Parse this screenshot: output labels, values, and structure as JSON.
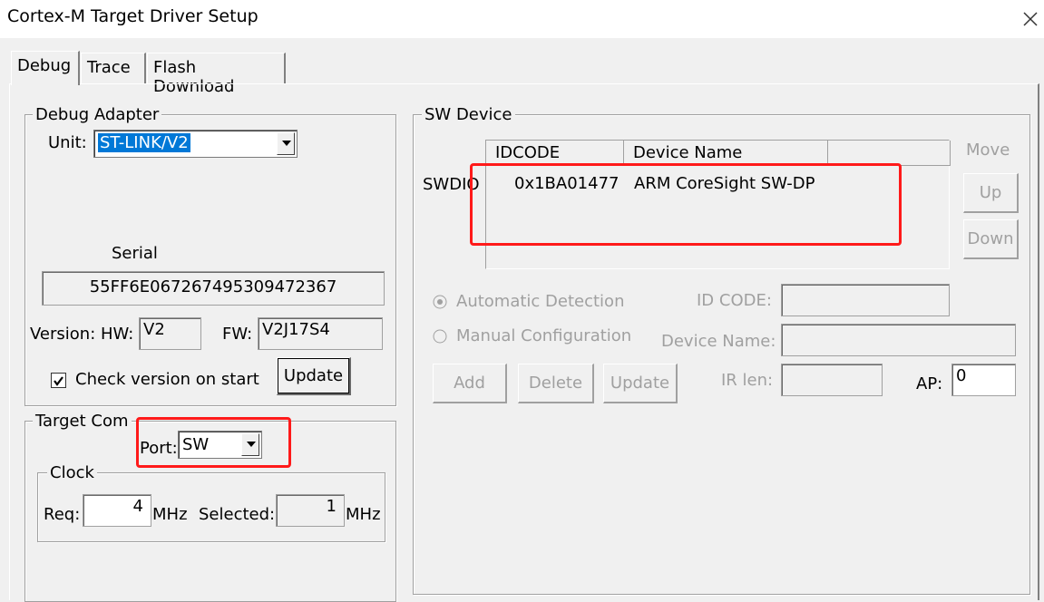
{
  "window": {
    "title": "Cortex-M Target Driver Setup"
  },
  "tabs": [
    {
      "label": "Debug",
      "active": true
    },
    {
      "label": "Trace",
      "active": false
    },
    {
      "label": "Flash Download",
      "active": false
    }
  ],
  "debug_adapter": {
    "group_label": "Debug Adapter",
    "unit_label": "Unit:",
    "unit_value": "ST-LINK/V2",
    "serial_label": "Serial",
    "serial_value": "55FF6E067267495309472367",
    "version_label": "Version: HW:",
    "hw_value": "V2",
    "fw_label": "FW:",
    "fw_value": "V2J17S4",
    "check_version_label": "Check version on start",
    "check_version_checked": true,
    "update_button": "Update"
  },
  "target_com": {
    "group_label": "Target Com",
    "port_label": "Port:",
    "port_value": "SW",
    "clock_label": "Clock",
    "req_label": "Req:",
    "req_value": "4",
    "mhz_label": "MHz",
    "selected_label": "Selected:",
    "selected_value": "1",
    "mhz_label_2": "MHz"
  },
  "sw_device": {
    "group_label": "SW Device",
    "columns": [
      "IDCODE",
      "Device Name"
    ],
    "row_label": "SWDIO",
    "rows": [
      {
        "idcode": "0x1BA01477",
        "device_name": "ARM CoreSight SW-DP"
      }
    ],
    "move_label": "Move",
    "up_button": "Up",
    "down_button": "Down",
    "auto_detect_label": "Automatic Detection",
    "manual_config_label": "Manual Configuration",
    "id_code_label": "ID CODE:",
    "id_code_value": "",
    "device_name_label": "Device Name:",
    "device_name_value": "",
    "add_button": "Add",
    "delete_button": "Delete",
    "update_button": "Update",
    "ir_len_label": "IR len:",
    "ir_len_value": "",
    "ap_label": "AP:",
    "ap_value": "0"
  },
  "colors": {
    "highlight": "#0078d7",
    "annotation": "#ff1a1a",
    "disabled_text": "#a0a0a0"
  }
}
